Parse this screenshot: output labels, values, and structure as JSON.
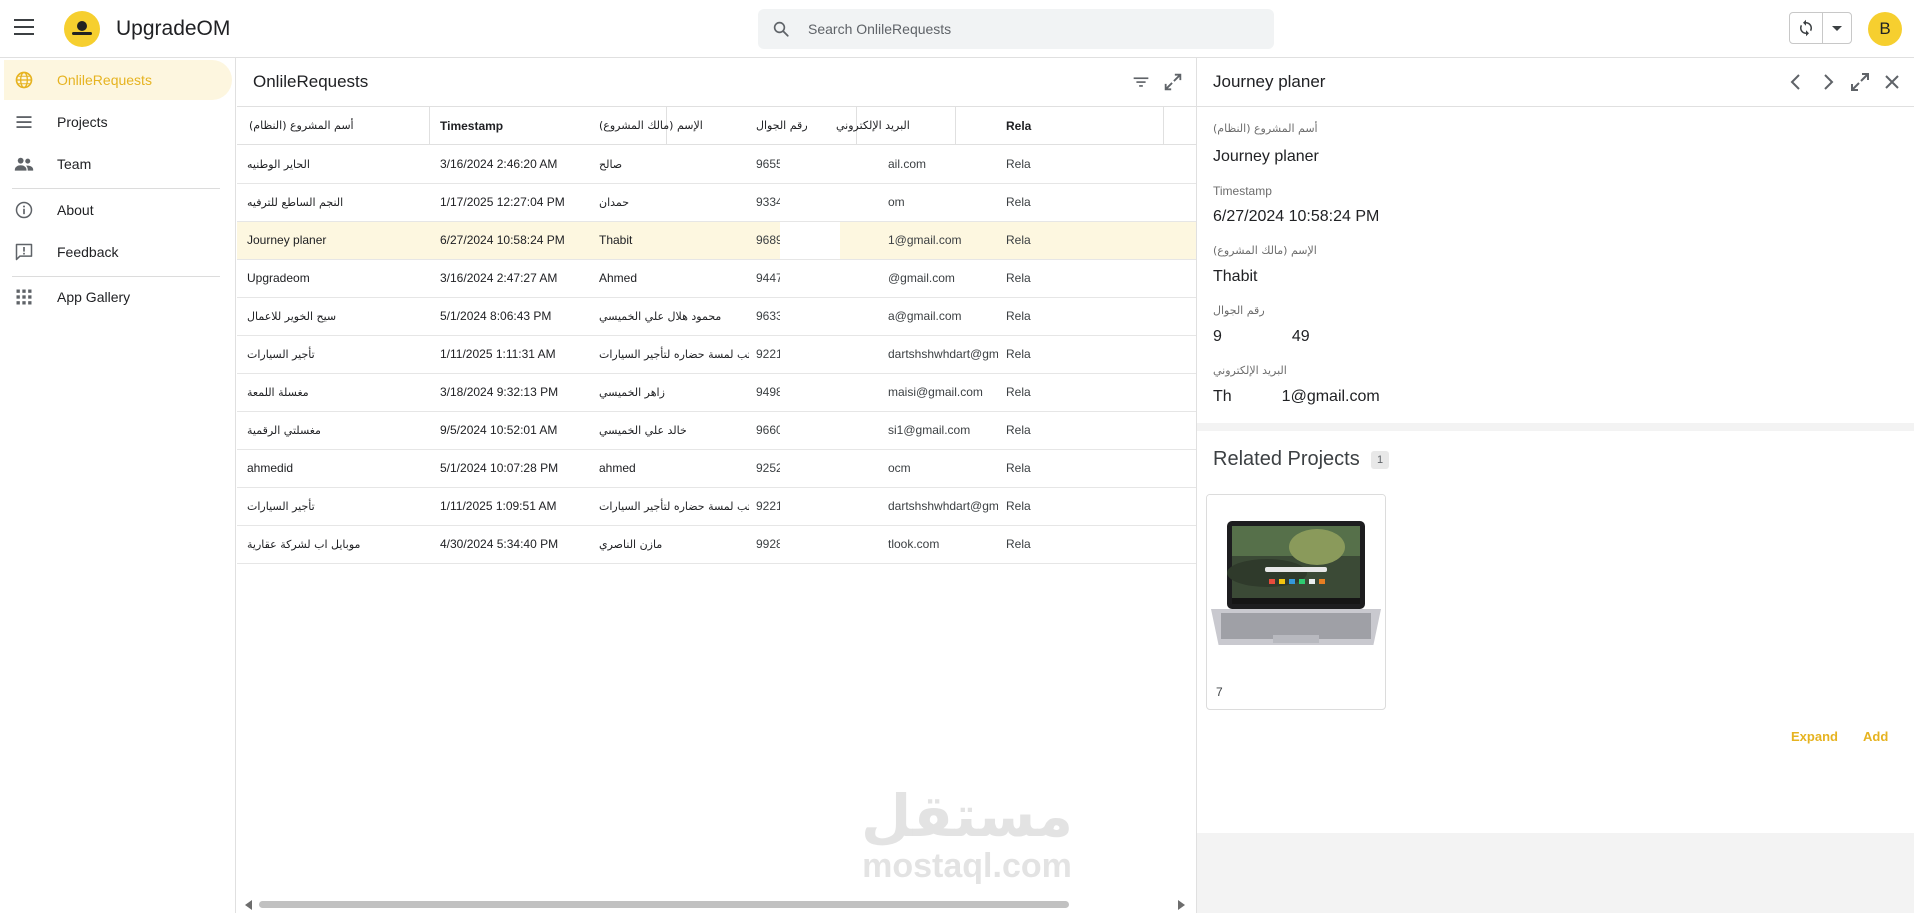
{
  "header": {
    "app_title": "UpgradeOM",
    "search_placeholder": "Search OnlileRequests",
    "avatar_initial": "B"
  },
  "sidebar": {
    "items": [
      {
        "label": "OnlileRequests",
        "icon": "globe-icon",
        "active": true
      },
      {
        "label": "Projects",
        "icon": "list-icon"
      },
      {
        "label": "Team",
        "icon": "people-icon"
      },
      {
        "label": "About",
        "icon": "info-icon"
      },
      {
        "label": "Feedback",
        "icon": "feedback-icon"
      },
      {
        "label": "App Gallery",
        "icon": "apps-grid-icon"
      }
    ]
  },
  "table": {
    "title": "OnlileRequests",
    "columns": [
      "أسم المشروع (النظام)",
      "Timestamp",
      "الإسم (مالك المشروع)",
      "رقم الجوال",
      "البريد الإلكتروني",
      "Rela"
    ],
    "rows": [
      {
        "project": "الحاير الوطنيه",
        "timestamp": "3/16/2024 2:46:20 AM",
        "owner": "صالح",
        "phone": "9655",
        "email": "ail.com",
        "rel": "Rela"
      },
      {
        "project": "النجم الساطع للترفيه",
        "timestamp": "1/17/2025 12:27:04 PM",
        "owner": "حمدان",
        "phone": "9334",
        "email": "om",
        "rel": "Rela"
      },
      {
        "project": "Journey planer",
        "timestamp": "6/27/2024 10:58:24 PM",
        "owner": "Thabit",
        "phone": "9689",
        "email": "1@gmail.com",
        "rel": "Rela",
        "selected": true
      },
      {
        "project": "Upgradeom",
        "timestamp": "3/16/2024 2:47:27 AM",
        "owner": "Ahmed",
        "phone": "9447",
        "email": "@gmail.com",
        "rel": "Rela"
      },
      {
        "project": "سيح الخوير للاعمال",
        "timestamp": "5/1/2024 8:06:43 PM",
        "owner": "محمود هلال علي الخميسي",
        "phone": "9633",
        "email": "a@gmail.com",
        "rel": "Rela"
      },
      {
        "project": "تأجير السيارات",
        "timestamp": "1/11/2025 1:11:31 AM",
        "owner": "مكتب لمسة حضاره لتأجير السيارات",
        "phone": "9221",
        "email": "dartshshwhdart@gm...",
        "rel": "Rela"
      },
      {
        "project": "مغسلة اللمعة",
        "timestamp": "3/18/2024 9:32:13 PM",
        "owner": "زاهر الخميسي",
        "phone": "9498",
        "email": "maisi@gmail.com",
        "rel": "Rela"
      },
      {
        "project": "مغسلتي الرقمية",
        "timestamp": "9/5/2024 10:52:01 AM",
        "owner": "خالد علي الخميسي",
        "phone": "9660",
        "email": "si1@gmail.com",
        "rel": "Rela"
      },
      {
        "project": "ahmedid",
        "timestamp": "5/1/2024 10:07:28 PM",
        "owner": "ahmed",
        "phone": "9252",
        "email": "ocm",
        "rel": "Rela"
      },
      {
        "project": "تأجير السيارات",
        "timestamp": "1/11/2025 1:09:51 AM",
        "owner": "مكتب لمسة حضاره لتأجير السيارات",
        "phone": "9221",
        "email": "dartshshwhdart@gm...",
        "rel": "Rela"
      },
      {
        "project": "موبايل اب لشركة عقارية",
        "timestamp": "4/30/2024 5:34:40 PM",
        "owner": "مازن الناصري",
        "phone": "9928",
        "email": "tlook.com",
        "rel": "Rela"
      }
    ]
  },
  "watermark": {
    "arabic": "مستقل",
    "latin": "mostaql.com"
  },
  "detail": {
    "title": "Journey planer",
    "fields": [
      {
        "label": "أسم المشروع (النظام)",
        "value": "Journey planer"
      },
      {
        "label": "Timestamp",
        "value": "6/27/2024 10:58:24 PM"
      },
      {
        "label": "الإسم (مالك المشروع)",
        "value": "Thabit"
      },
      {
        "label": "رقم الجوال",
        "value_start": "9",
        "value_end": "49"
      },
      {
        "label": "البريد الإلكتروني",
        "value_start": "Th",
        "value_end": "1@gmail.com"
      }
    ],
    "related": {
      "title": "Related Projects",
      "count": "1",
      "card_text": "7"
    },
    "actions": {
      "expand": "Expand",
      "add": "Add"
    }
  },
  "colors": {
    "accent": "#f6cf2f",
    "accent_text": "#e6b320",
    "selected_row": "#fdf7e0"
  }
}
